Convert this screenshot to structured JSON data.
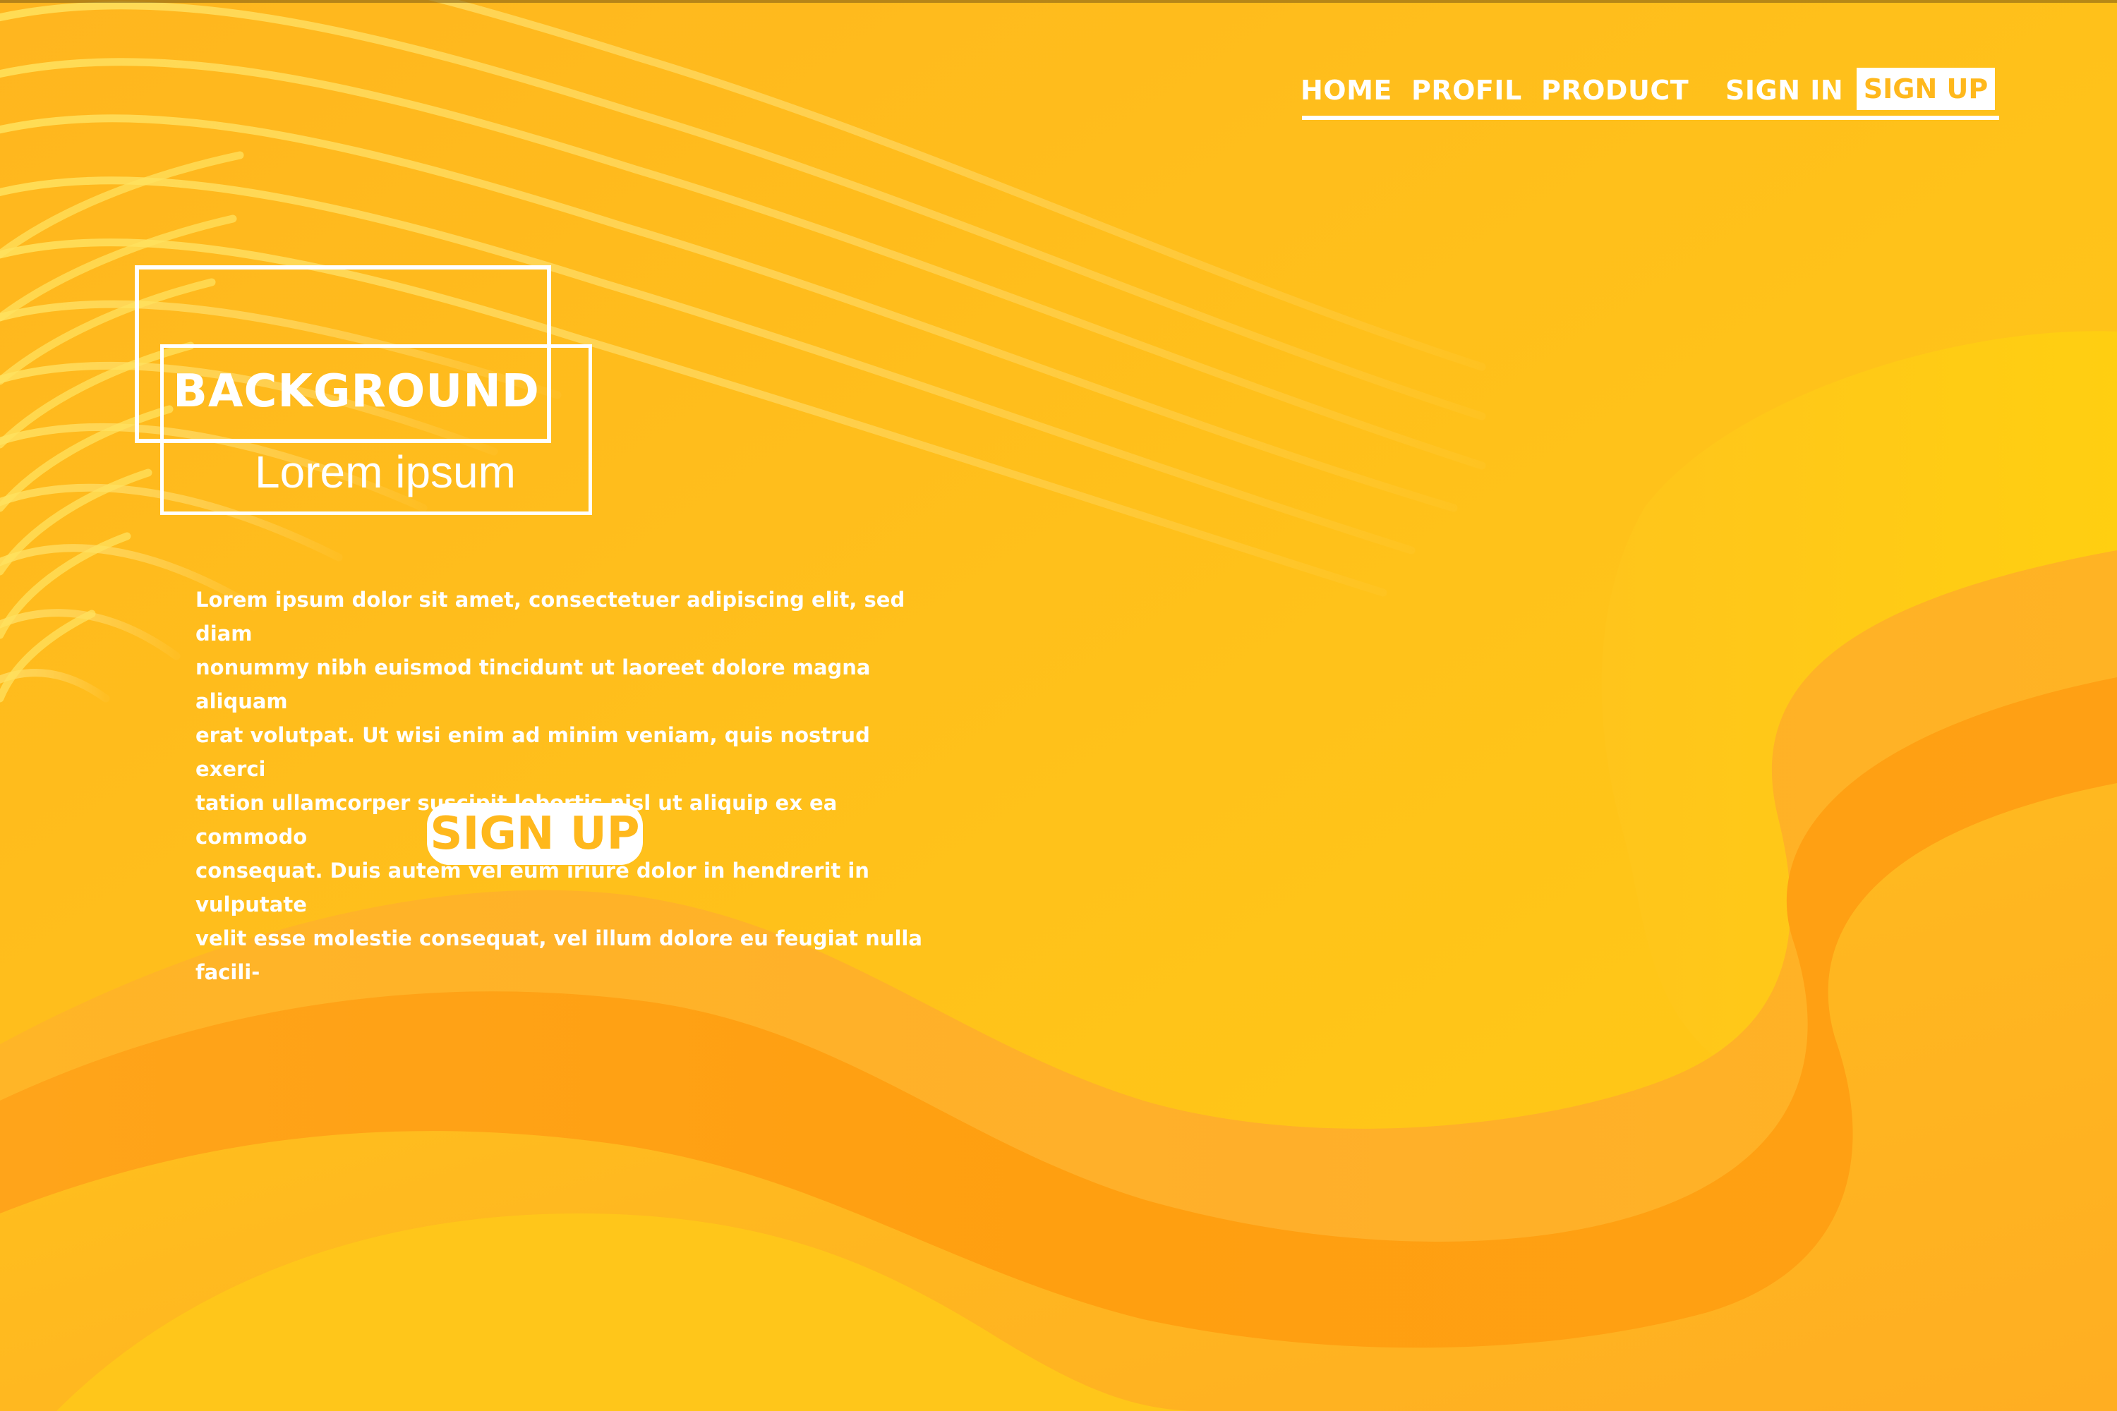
{
  "theme": {
    "accent": "#FFB81C",
    "text": "#FFFFFF"
  },
  "nav": {
    "items": [
      {
        "label": "HOME"
      },
      {
        "label": "PROFIL"
      },
      {
        "label": "PRODUCT"
      },
      {
        "label": "SIGN IN"
      }
    ],
    "signup_label": "SIGN UP"
  },
  "hero": {
    "title": "BACKGROUND",
    "subtitle": "Lorem ipsum",
    "body": "Lorem ipsum dolor sit amet, consectetuer adipiscing elit, sed diam\nnonummy nibh euismod tincidunt ut laoreet dolore magna aliquam\nerat volutpat. Ut wisi enim ad minim veniam, quis nostrud exerci\ntation ullamcorper suscipit lobortis nisl ut aliquip ex ea commodo\nconsequat. Duis autem vel eum iriure dolor in hendrerit in vulputate\nvelit esse molestie consequat, vel illum dolore eu feugiat nulla facili-",
    "cta_label": "SIGN UP"
  }
}
